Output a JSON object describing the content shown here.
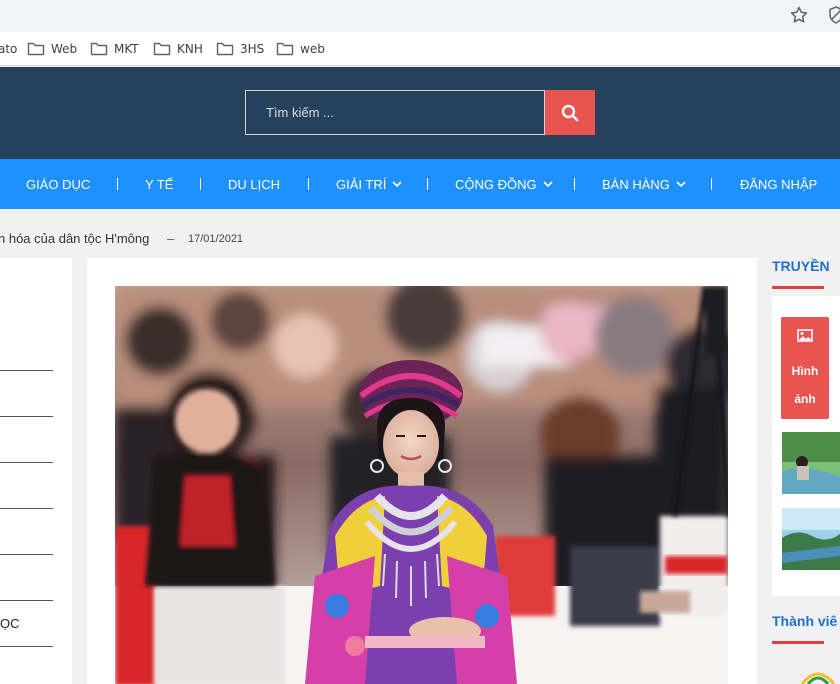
{
  "browser": {
    "bookmarks": [
      {
        "label": "ato",
        "icon": "none"
      },
      {
        "label": "Web",
        "icon": "folder-icon"
      },
      {
        "label": "MKT",
        "icon": "folder-icon"
      },
      {
        "label": "KNH",
        "icon": "folder-icon"
      },
      {
        "label": "3HS",
        "icon": "folder-icon"
      },
      {
        "label": "web",
        "icon": "folder-icon"
      }
    ],
    "icons": [
      "star-icon",
      "shield-icon"
    ]
  },
  "header": {
    "bg_color": "#26415c",
    "search": {
      "placeholder": "Tìm kiếm ...",
      "value": ""
    },
    "search_button_color": "#ea5450"
  },
  "nav": {
    "bg_color": "#1e90ff",
    "items": [
      {
        "label": "GIÁO DỤC",
        "dropdown": false
      },
      {
        "label": "Y TẾ",
        "dropdown": false
      },
      {
        "label": "DU LỊCH",
        "dropdown": false
      },
      {
        "label": "GIẢI TRÍ",
        "dropdown": true
      },
      {
        "label": "CỘNG ĐỒNG",
        "dropdown": true
      },
      {
        "label": "BÁN HÀNG",
        "dropdown": true
      },
      {
        "label": "ĐĂNG NHẬP",
        "dropdown": false
      }
    ]
  },
  "article": {
    "breadcrumb_title": "n hóa của dân tộc H'mông",
    "separator": "–",
    "date": "17/01/2021"
  },
  "left_sidebar": {
    "visible_text": "ỌC"
  },
  "right_sidebar": {
    "title": "TRUYỀN",
    "category_label_line1": "Hình",
    "category_label_line2": "ảnh",
    "section2_title": "Thành viê",
    "accent_color": "#e0413c"
  }
}
